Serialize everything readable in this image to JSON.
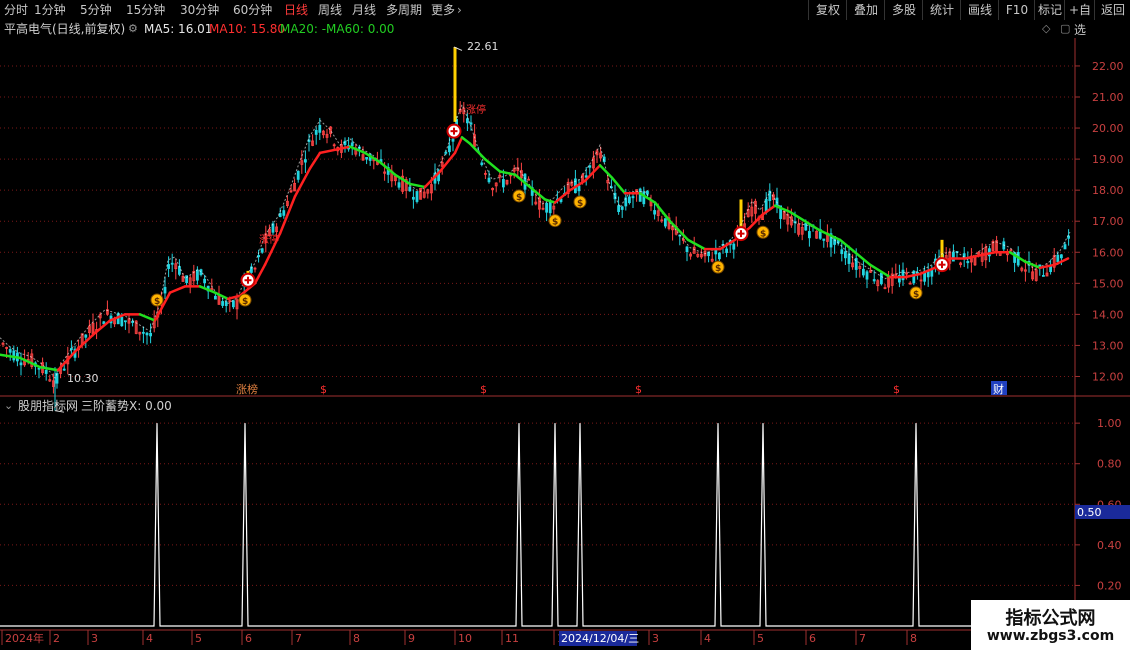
{
  "toolbar": {
    "periods": [
      "分时",
      "1分钟",
      "5分钟",
      "15分钟",
      "30分钟",
      "60分钟",
      "日线",
      "周线",
      "月线",
      "多周期",
      "更多"
    ],
    "active_period": "日线",
    "more_arrow": "›",
    "right_buttons": [
      "复权",
      "叠加",
      "多股",
      "统计",
      "画线",
      "F10",
      "标记",
      "+自选",
      "返回"
    ]
  },
  "main_chart": {
    "title": "平高电气(日线,前复权)",
    "ma": [
      {
        "label": "MA5: 16.01",
        "color": "#e6e6e6"
      },
      {
        "label": "MA10: 15.80",
        "color": "#ff3030"
      },
      {
        "label": "MA20: -",
        "color": "#22cc22"
      },
      {
        "label": "MA60: 0.00",
        "color": "#22cc22"
      }
    ],
    "high_label": "22.61",
    "low_label": "10.30",
    "zt_label": "涨停",
    "event_marks": [
      "涨榜",
      "$",
      "$",
      "$",
      "$",
      "财"
    ],
    "price_ticks": [
      "22.00",
      "21.00",
      "20.00",
      "19.00",
      "18.00",
      "17.00",
      "16.00",
      "15.00",
      "14.00",
      "13.00",
      "12.00"
    ]
  },
  "sub_chart": {
    "title": "股朋指标网",
    "indicator_label": "三阶蓄势X: 0.00",
    "ticks": [
      "1.00",
      "0.80",
      "0.60",
      "0.40",
      "0.20"
    ],
    "highlight_value": "0.50"
  },
  "time_axis": {
    "labels": [
      "2024年",
      "2",
      "3",
      "4",
      "5",
      "6",
      "7",
      "8",
      "9",
      "10",
      "11",
      "1",
      "2",
      "3",
      "4",
      "5",
      "6",
      "7",
      "8"
    ],
    "cursor_date": "2024/12/04/三"
  },
  "watermark": {
    "line1": "指标公式网",
    "line2": "www.zbgs3.com"
  },
  "chart_data": {
    "type": "line",
    "title": "平高电气(日线,前复权)",
    "y_range": [
      11.5,
      22.9
    ],
    "high": 22.61,
    "low": 10.3,
    "ma_last": {
      "MA5": 16.01,
      "MA10": 15.8
    },
    "close_path": [
      [
        0,
        13.1
      ],
      [
        10,
        12.8
      ],
      [
        20,
        12.6
      ],
      [
        30,
        12.5
      ],
      [
        40,
        12.3
      ],
      [
        50,
        12.0
      ],
      [
        55,
        11.8
      ],
      [
        62,
        12.3
      ],
      [
        75,
        12.9
      ],
      [
        90,
        13.5
      ],
      [
        105,
        14.0
      ],
      [
        125,
        13.8
      ],
      [
        140,
        13.5
      ],
      [
        150,
        13.3
      ],
      [
        160,
        14.2
      ],
      [
        168,
        15.6
      ],
      [
        175,
        15.7
      ],
      [
        185,
        15.0
      ],
      [
        198,
        15.3
      ],
      [
        205,
        15.1
      ],
      [
        215,
        14.6
      ],
      [
        228,
        14.2
      ],
      [
        238,
        14.4
      ],
      [
        246,
        15.1
      ],
      [
        255,
        15.5
      ],
      [
        265,
        16.4
      ],
      [
        278,
        17.0
      ],
      [
        290,
        17.9
      ],
      [
        300,
        18.8
      ],
      [
        310,
        19.6
      ],
      [
        320,
        20.1
      ],
      [
        330,
        19.8
      ],
      [
        340,
        19.3
      ],
      [
        350,
        19.5
      ],
      [
        360,
        19.2
      ],
      [
        372,
        19.0
      ],
      [
        385,
        18.6
      ],
      [
        398,
        18.3
      ],
      [
        410,
        18.0
      ],
      [
        420,
        17.8
      ],
      [
        432,
        18.2
      ],
      [
        445,
        19.0
      ],
      [
        455,
        20.0
      ],
      [
        462,
        20.6
      ],
      [
        470,
        20.0
      ],
      [
        480,
        19.0
      ],
      [
        492,
        18.2
      ],
      [
        505,
        18.3
      ],
      [
        517,
        18.6
      ],
      [
        530,
        18.0
      ],
      [
        542,
        17.4
      ],
      [
        554,
        17.6
      ],
      [
        565,
        18.0
      ],
      [
        580,
        18.2
      ],
      [
        592,
        18.8
      ],
      [
        600,
        19.3
      ],
      [
        610,
        18.0
      ],
      [
        620,
        17.3
      ],
      [
        630,
        17.8
      ],
      [
        645,
        17.8
      ],
      [
        660,
        17.2
      ],
      [
        675,
        16.6
      ],
      [
        690,
        16.0
      ],
      [
        705,
        15.8
      ],
      [
        718,
        16.0
      ],
      [
        730,
        16.2
      ],
      [
        742,
        16.8
      ],
      [
        752,
        17.5
      ],
      [
        760,
        17.2
      ],
      [
        770,
        17.8
      ],
      [
        780,
        17.3
      ],
      [
        795,
        16.8
      ],
      [
        810,
        16.7
      ],
      [
        825,
        16.5
      ],
      [
        840,
        16.1
      ],
      [
        855,
        15.6
      ],
      [
        870,
        15.3
      ],
      [
        885,
        15.0
      ],
      [
        900,
        15.2
      ],
      [
        915,
        15.2
      ],
      [
        930,
        15.4
      ],
      [
        942,
        15.8
      ],
      [
        955,
        15.9
      ],
      [
        968,
        15.6
      ],
      [
        980,
        15.9
      ],
      [
        995,
        16.2
      ],
      [
        1010,
        16.0
      ],
      [
        1022,
        15.6
      ],
      [
        1035,
        15.3
      ],
      [
        1048,
        15.5
      ],
      [
        1060,
        15.9
      ],
      [
        1070,
        16.5
      ]
    ],
    "ma10_path": [
      [
        0,
        12.7
      ],
      [
        20,
        12.6
      ],
      [
        40,
        12.3
      ],
      [
        58,
        12.2
      ],
      [
        75,
        12.8
      ],
      [
        95,
        13.4
      ],
      [
        110,
        13.8
      ],
      [
        125,
        14.0
      ],
      [
        140,
        14.0
      ],
      [
        155,
        13.8
      ],
      [
        170,
        14.7
      ],
      [
        185,
        14.9
      ],
      [
        200,
        14.9
      ],
      [
        215,
        14.7
      ],
      [
        228,
        14.5
      ],
      [
        240,
        14.6
      ],
      [
        255,
        15.0
      ],
      [
        265,
        15.6
      ],
      [
        280,
        16.6
      ],
      [
        295,
        17.8
      ],
      [
        310,
        18.7
      ],
      [
        320,
        19.2
      ],
      [
        335,
        19.3
      ],
      [
        350,
        19.4
      ],
      [
        365,
        19.2
      ],
      [
        380,
        18.9
      ],
      [
        395,
        18.5
      ],
      [
        410,
        18.2
      ],
      [
        425,
        18.1
      ],
      [
        440,
        18.6
      ],
      [
        455,
        19.2
      ],
      [
        462,
        19.7
      ],
      [
        470,
        19.5
      ],
      [
        485,
        19.0
      ],
      [
        500,
        18.6
      ],
      [
        515,
        18.5
      ],
      [
        530,
        18.1
      ],
      [
        545,
        17.7
      ],
      [
        555,
        17.6
      ],
      [
        570,
        18.0
      ],
      [
        585,
        18.3
      ],
      [
        600,
        18.8
      ],
      [
        612,
        18.4
      ],
      [
        625,
        17.9
      ],
      [
        640,
        17.9
      ],
      [
        655,
        17.6
      ],
      [
        670,
        17.0
      ],
      [
        688,
        16.4
      ],
      [
        705,
        16.1
      ],
      [
        720,
        16.1
      ],
      [
        735,
        16.4
      ],
      [
        750,
        16.8
      ],
      [
        762,
        17.2
      ],
      [
        775,
        17.5
      ],
      [
        790,
        17.3
      ],
      [
        805,
        17.0
      ],
      [
        820,
        16.7
      ],
      [
        840,
        16.4
      ],
      [
        855,
        16.0
      ],
      [
        870,
        15.6
      ],
      [
        890,
        15.2
      ],
      [
        905,
        15.2
      ],
      [
        920,
        15.3
      ],
      [
        935,
        15.5
      ],
      [
        950,
        15.8
      ],
      [
        965,
        15.8
      ],
      [
        980,
        15.9
      ],
      [
        995,
        16.0
      ],
      [
        1010,
        16.0
      ],
      [
        1025,
        15.7
      ],
      [
        1040,
        15.5
      ],
      [
        1055,
        15.6
      ],
      [
        1068,
        15.8
      ]
    ],
    "signals_x": [
      157,
      245,
      519,
      555,
      580,
      718,
      763,
      916
    ],
    "buy_points": [
      [
        248,
        15.1
      ],
      [
        454,
        19.9
      ],
      [
        741,
        16.6
      ],
      [
        942,
        15.6
      ]
    ],
    "sub_ylim": [
      0,
      1.05
    ]
  }
}
